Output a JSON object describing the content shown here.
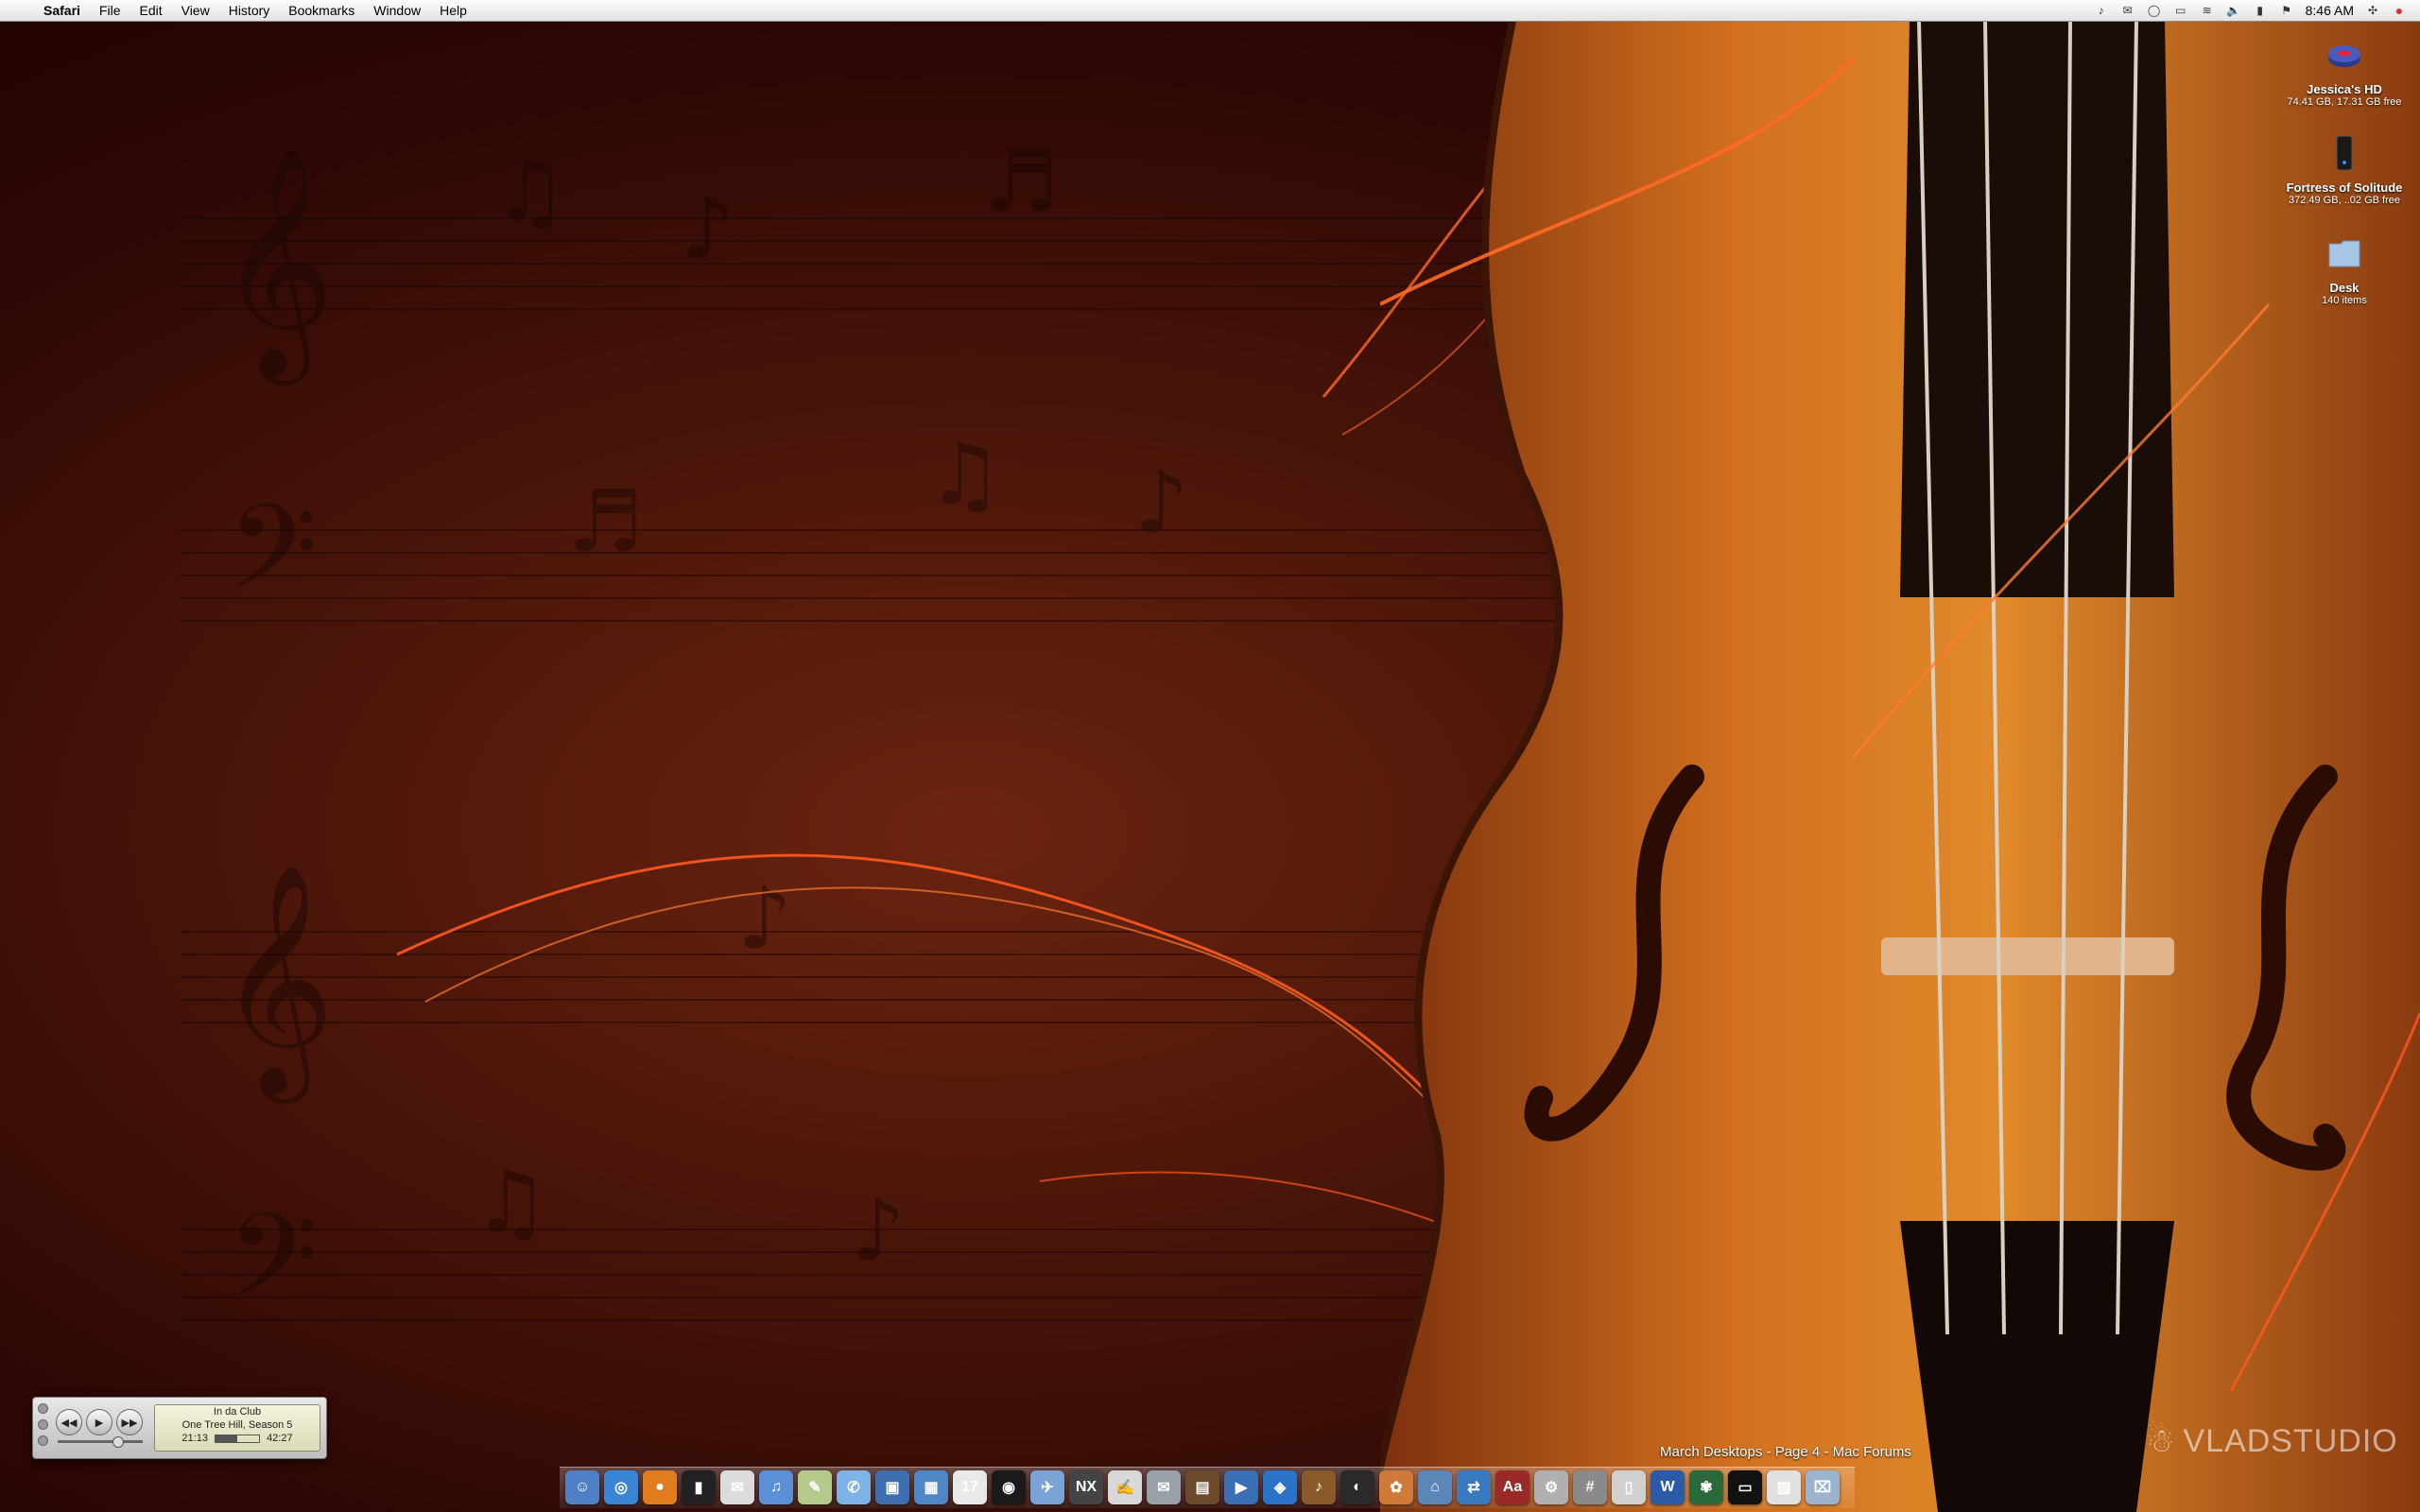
{
  "menubar": {
    "app_name": "Safari",
    "menus": [
      "File",
      "Edit",
      "View",
      "History",
      "Bookmarks",
      "Window",
      "Help"
    ],
    "clock": "8:46 AM"
  },
  "desktop_icons": [
    {
      "name": "Jessica's HD",
      "sub": "74.41 GB, 17.31 GB free",
      "icon": "internal-drive-icon"
    },
    {
      "name": "Fortress of Solitude",
      "sub": "372.49 GB, ..02 GB free",
      "icon": "external-drive-icon"
    },
    {
      "name": "Desk",
      "sub": "140 items",
      "icon": "folder-icon"
    }
  ],
  "mini_player": {
    "title": "In da Club",
    "subtitle": "One Tree Hill, Season 5",
    "elapsed": "21:13",
    "total": "42:27",
    "progress": 0.5
  },
  "dock": {
    "tooltip": "March Desktops - Page 4 - Mac Forums",
    "items": [
      {
        "name": "finder",
        "color": "#4f7fc4",
        "glyph": "☺"
      },
      {
        "name": "safari",
        "color": "#3a86d6",
        "glyph": "◎"
      },
      {
        "name": "firefox",
        "color": "#e07b1e",
        "glyph": "●"
      },
      {
        "name": "iphone",
        "color": "#222222",
        "glyph": "▮"
      },
      {
        "name": "mail",
        "color": "#dcdcdc",
        "glyph": "✉"
      },
      {
        "name": "itunes",
        "color": "#5b8fd8",
        "glyph": "♫"
      },
      {
        "name": "textedit",
        "color": "#b5c98a",
        "glyph": "✎"
      },
      {
        "name": "ichat",
        "color": "#7fb3e8",
        "glyph": "✆"
      },
      {
        "name": "preview",
        "color": "#3d6fb0",
        "glyph": "▣"
      },
      {
        "name": "iphoto",
        "color": "#4f86c6",
        "glyph": "▦"
      },
      {
        "name": "ical",
        "color": "#e9e9e9",
        "glyph": "17"
      },
      {
        "name": "dvd-player",
        "color": "#1a1a1a",
        "glyph": "◉"
      },
      {
        "name": "mail-app",
        "color": "#7aa4d6",
        "glyph": "✈"
      },
      {
        "name": "nx",
        "color": "#444444",
        "glyph": "NX"
      },
      {
        "name": "script-editor",
        "color": "#d8d8d8",
        "glyph": "✍"
      },
      {
        "name": "stamp",
        "color": "#9aa0a8",
        "glyph": "✉"
      },
      {
        "name": "photo-booth",
        "color": "#6a4a2a",
        "glyph": "▤"
      },
      {
        "name": "imovie",
        "color": "#3b6fb5",
        "glyph": "▶"
      },
      {
        "name": "idvd",
        "color": "#2a73c9",
        "glyph": "◈"
      },
      {
        "name": "garageband",
        "color": "#8a5a2a",
        "glyph": "♪"
      },
      {
        "name": "front-row",
        "color": "#2a2a2a",
        "glyph": "◐"
      },
      {
        "name": "growl",
        "color": "#d07a3a",
        "glyph": "✿"
      },
      {
        "name": "iweb",
        "color": "#5a86b8",
        "glyph": "⌂"
      },
      {
        "name": "network-utility",
        "color": "#3a78c0",
        "glyph": "⇄"
      },
      {
        "name": "dictionary",
        "color": "#9a2a2a",
        "glyph": "Aa"
      },
      {
        "name": "system-prefs",
        "color": "#b0b0b0",
        "glyph": "⚙"
      },
      {
        "name": "calculator",
        "color": "#8a8a8a",
        "glyph": "#"
      },
      {
        "name": "utility",
        "color": "#d0d0d0",
        "glyph": "▯"
      },
      {
        "name": "word",
        "color": "#2b5aa8",
        "glyph": "W"
      },
      {
        "name": "plant",
        "color": "#2a6a3a",
        "glyph": "✾"
      },
      {
        "name": "terminal",
        "color": "#111111",
        "glyph": "▭"
      },
      {
        "name": "screenshot",
        "color": "#e0e0e0",
        "glyph": "▧"
      },
      {
        "name": "trash",
        "color": "#9cb3cc",
        "glyph": "⌧"
      }
    ]
  },
  "watermark": "VLADSTUDIO",
  "colors": {
    "accent": "#ff5a1e",
    "wood": "#c4621e"
  }
}
